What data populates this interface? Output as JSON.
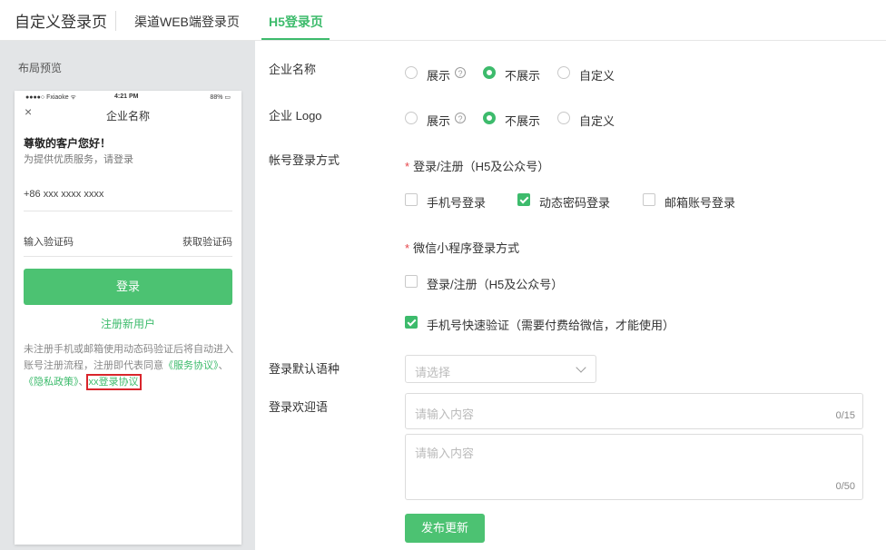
{
  "header": {
    "title": "自定义登录页",
    "tabs": [
      {
        "label": "渠道WEB端登录页"
      },
      {
        "label": "H5登录页"
      }
    ]
  },
  "preview": {
    "label": "布局预览",
    "status": {
      "carrier": "●●●●○ Fxiaoke ᯤ",
      "time": "4:21 PM",
      "battery": "88% ▭"
    },
    "close": "×",
    "title": "企业名称",
    "greeting": "尊敬的客户您好！",
    "sub_greeting": "为提供优质服务，请登录",
    "phone_placeholder": "+86 xxx xxxx xxxx",
    "code_label": "输入验证码",
    "get_code": "获取验证码",
    "login_button": "登录",
    "register": "注册新用户",
    "terms_text": "未注册手机或邮箱使用动态码验证后将自动进入账号注册流程，注册即代表同意",
    "terms_link1": "《服务协议》",
    "terms_sep1": "、",
    "terms_link2": "《隐私政策》",
    "terms_sep2": "、",
    "terms_link3": "xx登录协议"
  },
  "form": {
    "company_name": {
      "label": "企业名称",
      "options": [
        "展示",
        "不展示",
        "自定义"
      ],
      "selected": "不展示"
    },
    "company_logo": {
      "label": "企业 Logo",
      "options": [
        "展示",
        "不展示",
        "自定义"
      ],
      "selected": "不展示"
    },
    "help_icon": "?",
    "account_login": {
      "label": "帐号登录方式",
      "h5_section": "登录/注册（H5及公众号）",
      "required_mark": "*",
      "h5_options": [
        {
          "label": "手机号登录",
          "checked": false
        },
        {
          "label": "动态密码登录",
          "checked": true
        },
        {
          "label": "邮箱账号登录",
          "checked": false
        }
      ],
      "mini_section": "微信小程序登录方式",
      "mini_options": [
        {
          "label": "登录/注册（H5及公众号）",
          "checked": false
        },
        {
          "label": "手机号快速验证（需要付费给微信，才能使用）",
          "checked": true
        }
      ]
    },
    "default_language": {
      "label": "登录默认语种",
      "placeholder": "请选择"
    },
    "welcome": {
      "label": "登录欢迎语",
      "placeholder1": "请输入内容",
      "count1": "0/15",
      "placeholder2": "请输入内容",
      "count2": "0/50"
    },
    "publish_button": "发布更新"
  },
  "colors": {
    "accent": "#3dbb6c",
    "button": "#4cc272",
    "highlight_border": "#d9252c",
    "required": "#e6454a"
  }
}
